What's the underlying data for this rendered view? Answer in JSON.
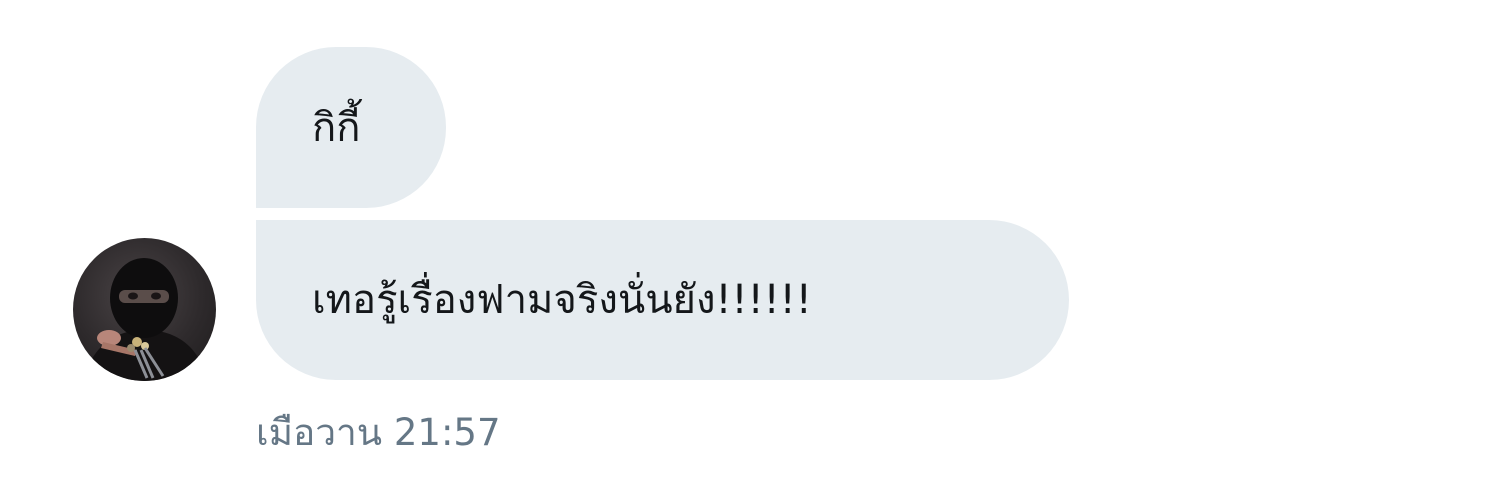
{
  "conversation": {
    "messages": [
      {
        "text": "กิกี้"
      },
      {
        "text": "เทอรู้เรื่องฟามจริงนั่นยัง!!!!!!"
      }
    ],
    "timestamp": "เมือวาน 21:57"
  },
  "colors": {
    "bubble_background": "#e6ecf0",
    "message_text": "#14171a",
    "timestamp_text": "#657786",
    "page_background": "#ffffff"
  },
  "avatar": {
    "icon": "masked-person-avatar"
  }
}
